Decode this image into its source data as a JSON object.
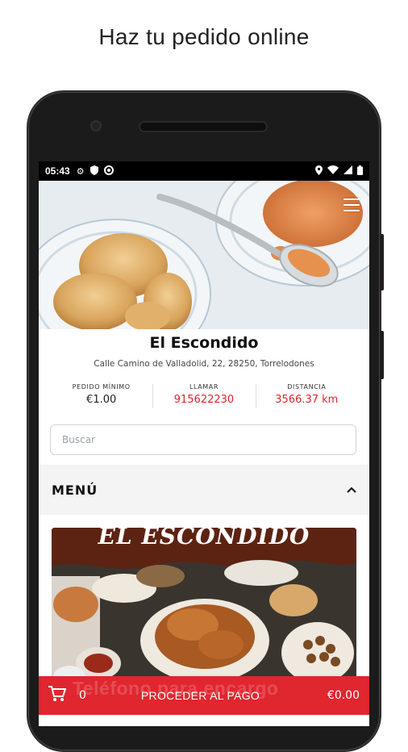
{
  "caption": "Haz tu pedido online",
  "status_bar": {
    "time": "05:43"
  },
  "restaurant": {
    "name": "El Escondido",
    "address": "Calle Camino de Valladolid, 22, 28250, Torrelodones"
  },
  "stats": [
    {
      "label": "PEDIDO MÍNIMO",
      "value": "€1.00",
      "accent": false
    },
    {
      "label": "LLAMAR",
      "value": "915622230",
      "accent": true
    },
    {
      "label": "DISTANCIA",
      "value": "3566.37  km",
      "accent": true
    }
  ],
  "search": {
    "placeholder": "Buscar"
  },
  "menu": {
    "title": "MENÚ"
  },
  "banner": {
    "title": "EL ESCONDIDO"
  },
  "cart": {
    "ghost_text": "Teléfono para encargo",
    "count": "0",
    "proceed_label": "PROCEDER AL PAGO",
    "total": "€0.00"
  },
  "colors": {
    "accent": "#e0262f",
    "banner_top": "#5c2313"
  }
}
